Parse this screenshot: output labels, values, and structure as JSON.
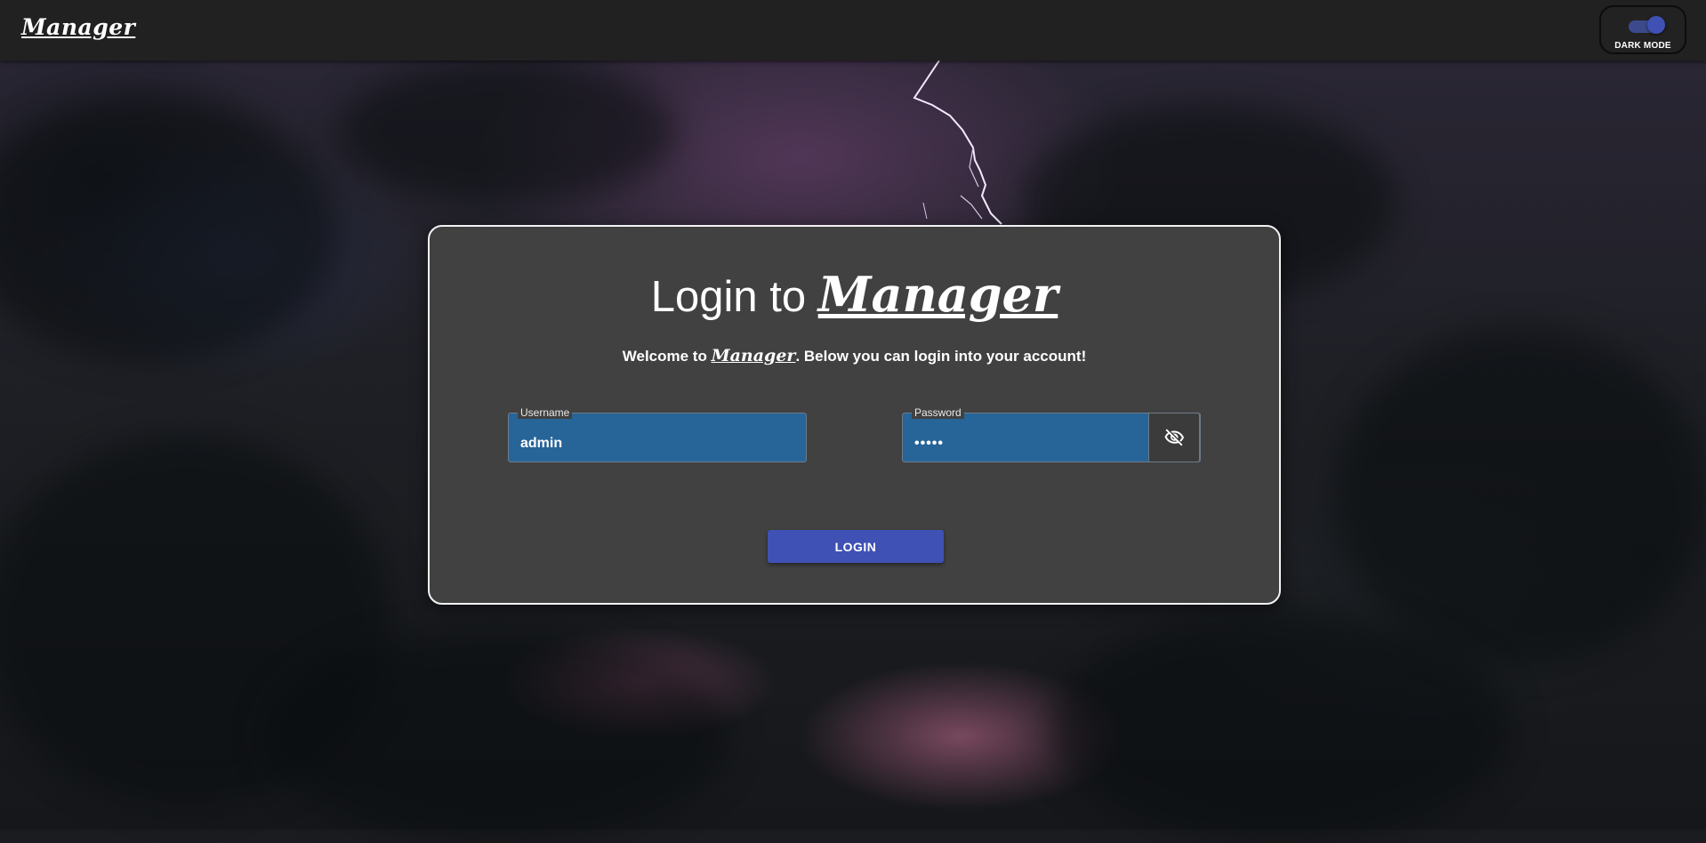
{
  "header": {
    "brand": "Manager",
    "dark_mode": {
      "label": "DARK MODE",
      "enabled": true,
      "accent": "#3f51b5"
    }
  },
  "login_card": {
    "title_prefix": "Login to ",
    "title_brand": "Manager",
    "subtitle_prefix": "Welcome to ",
    "subtitle_brand": "Manager",
    "subtitle_suffix": ". Below you can login into your account!",
    "username": {
      "label": "Username",
      "value": "admin"
    },
    "password": {
      "label": "Password",
      "value": "•••••",
      "toggle_icon": "eye-off-icon"
    },
    "login_button": "LOGIN"
  },
  "colors": {
    "header_bg": "#212121",
    "card_bg": "#414141",
    "field_bg": "#276497",
    "button_bg": "#3f51b5"
  }
}
